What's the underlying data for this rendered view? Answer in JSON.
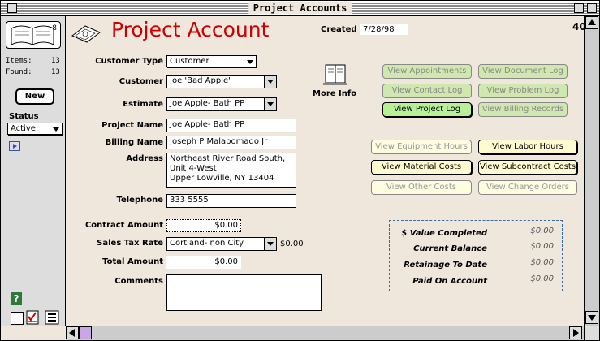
{
  "window": {
    "title": "Project Accounts"
  },
  "sidebar": {
    "book_count": "8",
    "items_label": "Items:",
    "items_value": "13",
    "found_label": "Found:",
    "found_value": "13",
    "new_label": "New",
    "status_label": "Status",
    "status_value": "Active"
  },
  "header": {
    "title": "Project Account",
    "created_label": "Created",
    "created_value": "7/28/98",
    "record_number": "40"
  },
  "form": {
    "customer_type_label": "Customer Type",
    "customer_type_value": "Customer",
    "customer_label": "Customer",
    "customer_value": "Joe 'Bad Apple'",
    "estimate_label": "Estimate",
    "estimate_value": "Joe Apple- Bath PP",
    "project_name_label": "Project Name",
    "project_name_value": "Joe Apple- Bath PP",
    "billing_name_label": "Billing Name",
    "billing_name_value": "Joseph P Malapomado Jr",
    "address_label": "Address",
    "address_value": "Northeast River Road South, Unit 4-West\nUpper Lowville, NY 13404",
    "telephone_label": "Telephone",
    "telephone_value": "333 5555",
    "contract_amount_label": "Contract Amount",
    "contract_amount_value": "$0.00",
    "sales_tax_label": "Sales Tax Rate",
    "sales_tax_value": "Cortland- non City",
    "sales_tax_amount": "$0.00",
    "total_amount_label": "Total Amount",
    "total_amount_value": "$0.00",
    "comments_label": "Comments",
    "comments_value": ""
  },
  "more_info_label": "More Info",
  "buttons": {
    "appointments": "View Appointments",
    "document_log": "View Document Log",
    "contact_log": "View Contact Log",
    "problem_log": "View Problem Log",
    "project_log": "View Project Log",
    "billing_records": "View Billing Records",
    "equipment_hours": "View Equipment Hours",
    "labor_hours": "View Labor Hours",
    "material_costs": "View Material Costs",
    "subcontract_costs": "View Subcontract Costs",
    "other_costs": "View Other Costs",
    "change_orders": "View Change Orders"
  },
  "summary": {
    "value_completed_label": "$ Value Completed",
    "value_completed": "$0.00",
    "current_balance_label": "Current Balance",
    "current_balance": "$0.00",
    "retainage_label": "Retainage To Date",
    "retainage": "$0.00",
    "paid_label": "Paid On Account",
    "paid": "$0.00"
  },
  "colors": {
    "title_red": "#cc0000",
    "green_button": "#cfe8b0",
    "yellow_button": "#fffde0"
  }
}
